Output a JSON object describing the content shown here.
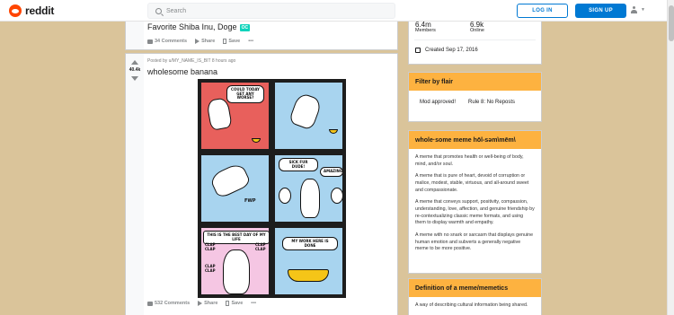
{
  "header": {
    "logo_text": "reddit",
    "search_placeholder": "Search",
    "login_label": "LOG IN",
    "signup_label": "SIGN UP"
  },
  "post1": {
    "title": "Favorite Shiba Inu, Doge",
    "badge": "OC",
    "comments": "34 Comments",
    "share": "Share",
    "save": "Save",
    "more": "•••"
  },
  "post2": {
    "score": "40.4k",
    "posted_by": "Posted by u/MY_NAME_IS_BIT 8 hours ago",
    "title": "wholesome banana",
    "comments": "532 Comments",
    "share": "Share",
    "save": "Save",
    "more": "•••",
    "comic_text": {
      "p1": "COULD TODAY GET ANY WORSE?",
      "p4a": "SICK FUR DUDE!",
      "p4b": "AMAZING!",
      "p3": "FWP",
      "p5": "THIS IS THE BEST DAY OF MY LIFE",
      "clap1": "CLAP CLAP",
      "clap2": "CLAP CLAP",
      "clap3": "CLAP CLAP",
      "p6": "MY WORK HERE IS DONE"
    }
  },
  "sidebar": {
    "members_count": "6.4m",
    "members_label": "Members",
    "online_count": "6.9k",
    "online_label": "Online",
    "created": "Created Sep 17, 2016",
    "flair_title": "Filter by flair",
    "flairs": [
      "Mod approved!",
      "Rule 8: No Reposts"
    ],
    "def_title": "whole·some meme hōl-səm\\mēm\\",
    "def_paragraphs": [
      "A meme that promotes health or well-being of body, mind, and/or soul.",
      "A meme that is pure of heart, devoid of corruption or malice, modest, stable, virtuous, and all-around sweet and compassionate.",
      "A meme that conveys support, positivity, compassion, understanding, love, affection, and genuine friendship by re-contextualizing classic meme formats, and using them to display warmth and empathy.",
      "A meme with no snark or sarcasm that displays genuine human emotion and subverts a generally negative meme to be more positive."
    ],
    "def2_title": "Definition of a meme/memetics",
    "def2_text": "A way of describing cultural information being shared."
  },
  "colors": {
    "accent_orange": "#fdb240",
    "reddit_orange": "#ff4500",
    "link_blue": "#0079d3",
    "page_bg": "#dac49a"
  }
}
